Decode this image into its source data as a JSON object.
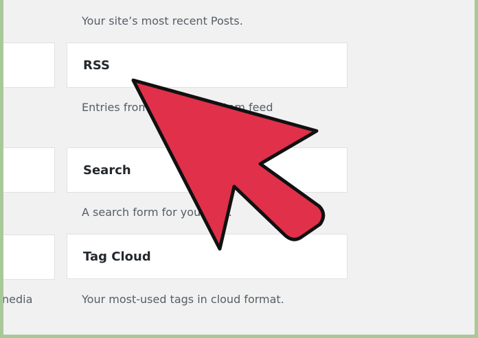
{
  "top_description": "Your site’s most recent Posts.",
  "widgets": [
    {
      "title": "RSS",
      "description": "Entries from any RSS or Atom feed"
    },
    {
      "title": "Search",
      "description": "A search form for your site."
    },
    {
      "title": "Tag Cloud",
      "description": "Your most-used tags in cloud format."
    }
  ],
  "left_column_fragment": "nedia",
  "cursor": {
    "icon": "arrow-pointer-icon",
    "fill": "#e0304a",
    "stroke": "#111111"
  }
}
